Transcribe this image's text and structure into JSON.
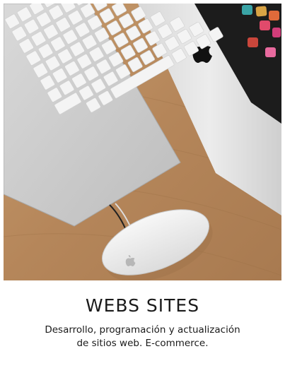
{
  "card": {
    "title": "WEBS SITES",
    "description_line1": "Desarrollo, programación y actualización",
    "description_line2": "de sitios web. E-commerce."
  },
  "photo": {
    "subject_icons": [
      "keyboard-icon",
      "mouse-icon",
      "monitor-icon",
      "apple-logo-icon"
    ]
  },
  "colors": {
    "title_text": "#1a1a1a",
    "background": "#ffffff",
    "desk_wood": "#b88a5e"
  }
}
